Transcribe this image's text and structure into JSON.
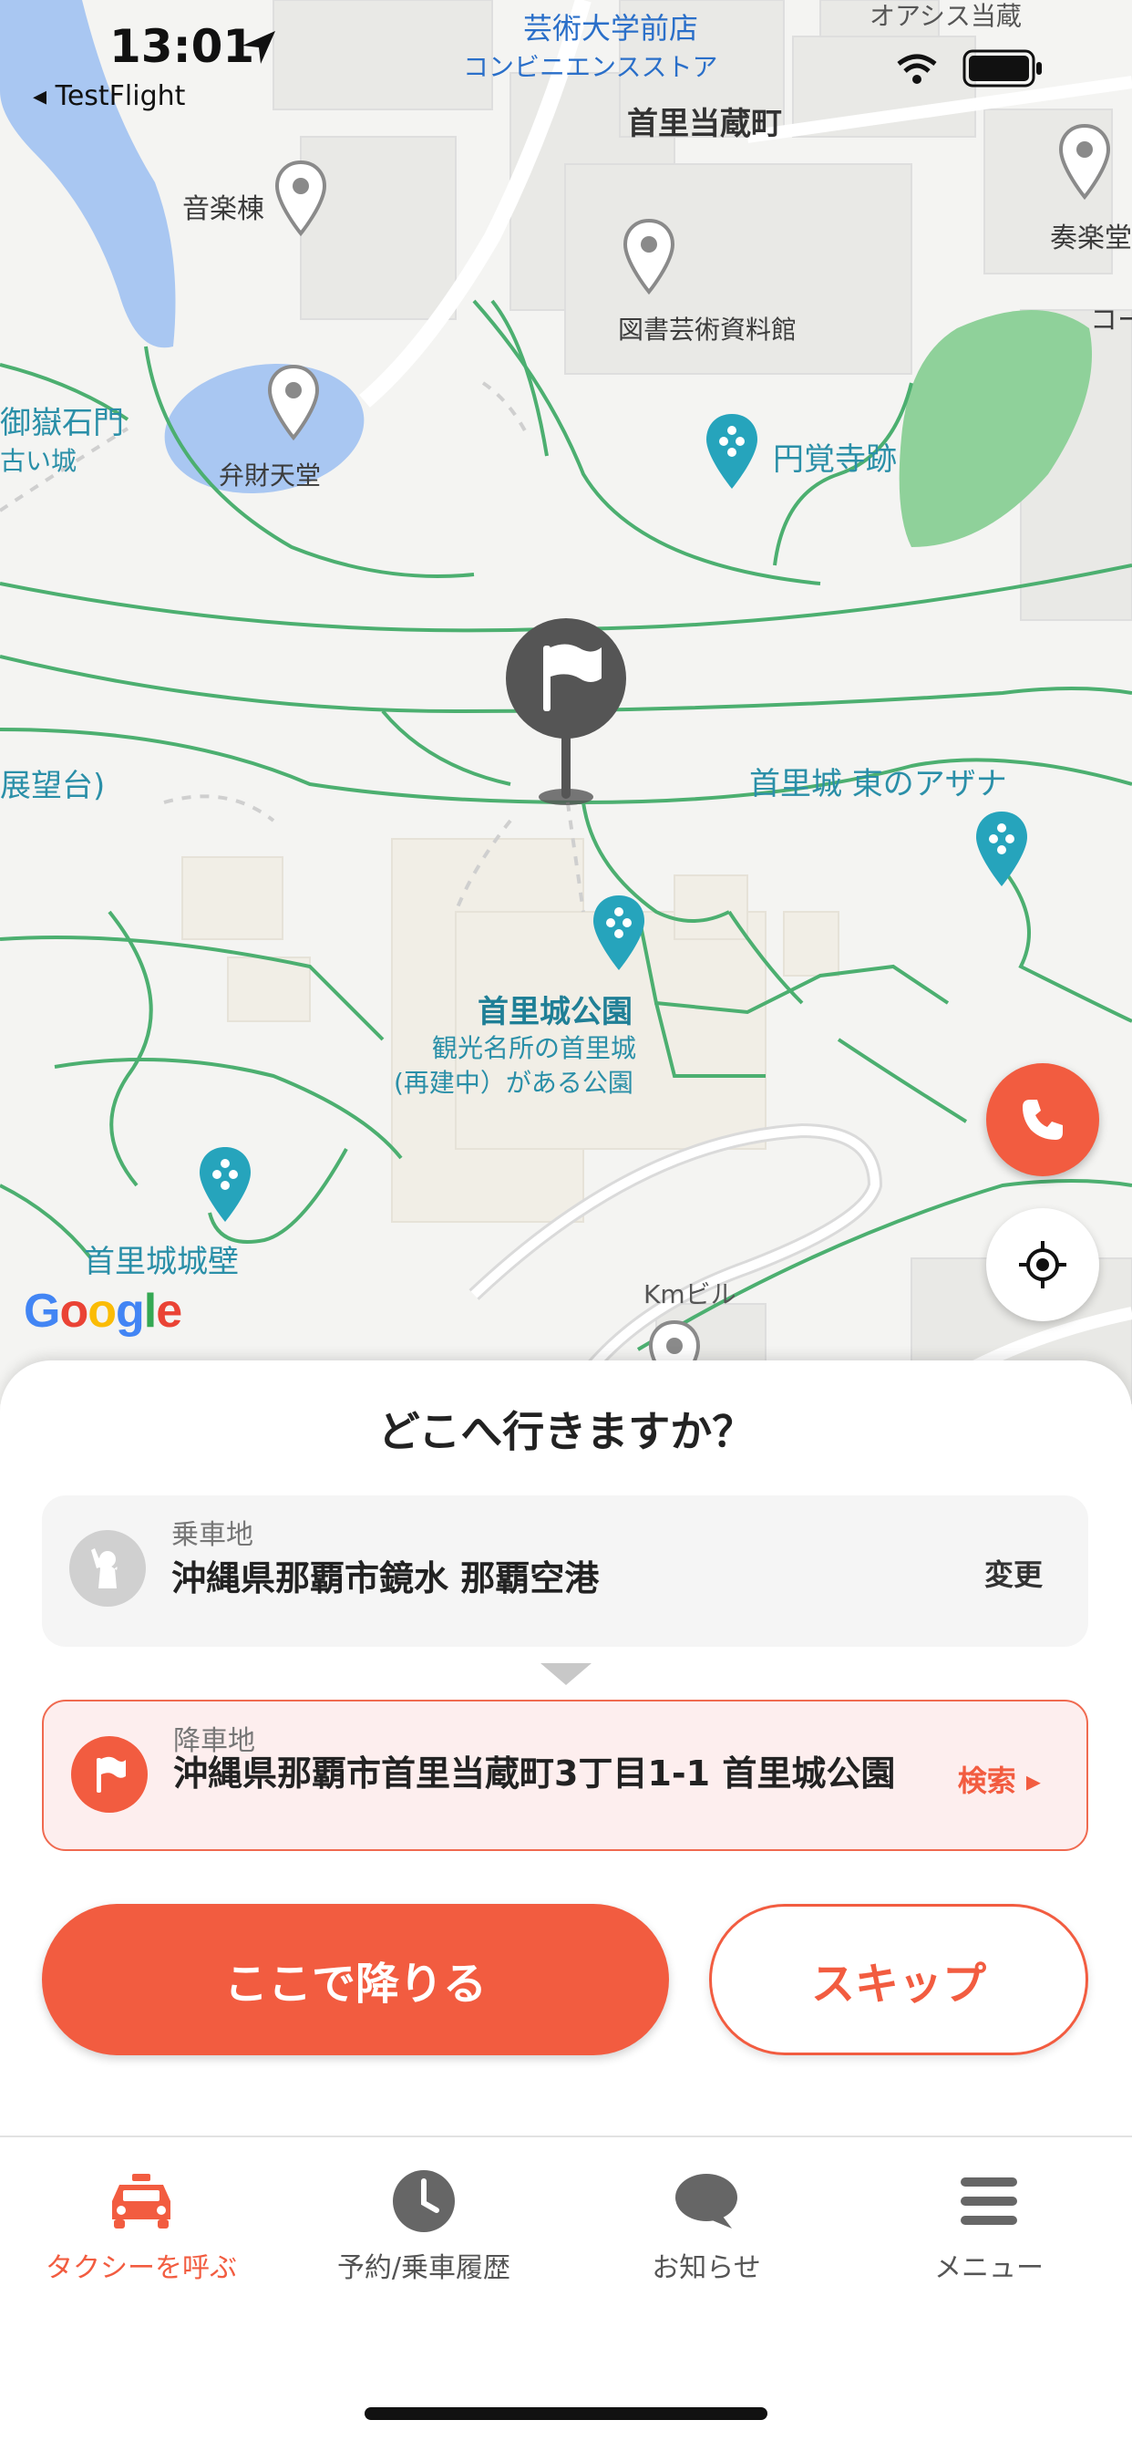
{
  "status_bar": {
    "time": "13:01",
    "back_app": "◂ TestFlight"
  },
  "map": {
    "labels": {
      "store_name": "芸術大学前店",
      "store_type": "コンビニエンスストア",
      "top_right": "オアシス当蔵",
      "district": "首里当蔵町",
      "music_hall": "音楽棟",
      "library": "図書芸術資料館",
      "ensou": "奏楽堂",
      "ko": "コー",
      "benzaiten": "弁財天堂",
      "engakuji": "円覚寺跡",
      "utaki_gate": "御嶽石門",
      "old_castle": "古い城",
      "observatory": "展望台)",
      "east_azana": "首里城 東のアザナ",
      "park_name": "首里城公園",
      "park_desc1": "観光名所の首里城",
      "park_desc2": "(再建中）がある公園",
      "castle_wall": "首里城城壁",
      "km_building": "Kmビル"
    },
    "google_logo": "Google"
  },
  "sheet": {
    "title": "どこへ行きますか？",
    "pickup": {
      "label": "乗車地",
      "address": "沖縄県那覇市鏡水  那覇空港",
      "action": "変更"
    },
    "dropoff": {
      "label": "降車地",
      "address": "沖縄県那覇市首里当蔵町3丁目1-1  首里城公園",
      "action": "検索 ▸"
    },
    "primary_button": "ここで降りる",
    "secondary_button": "スキップ"
  },
  "tabs": [
    {
      "label": "タクシーを呼ぶ",
      "icon": "taxi-icon",
      "active": true
    },
    {
      "label": "予約/乗車履歴",
      "icon": "clock-icon",
      "active": false
    },
    {
      "label": "お知らせ",
      "icon": "chat-bubble-icon",
      "active": false
    },
    {
      "label": "メニュー",
      "icon": "hamburger-menu-icon",
      "active": false
    }
  ],
  "colors": {
    "accent": "#f25c40",
    "map_bg": "#f4f4f2",
    "path_green": "#4caf70",
    "water": "#a9c7f2",
    "teal_poi": "#26a4bc"
  }
}
